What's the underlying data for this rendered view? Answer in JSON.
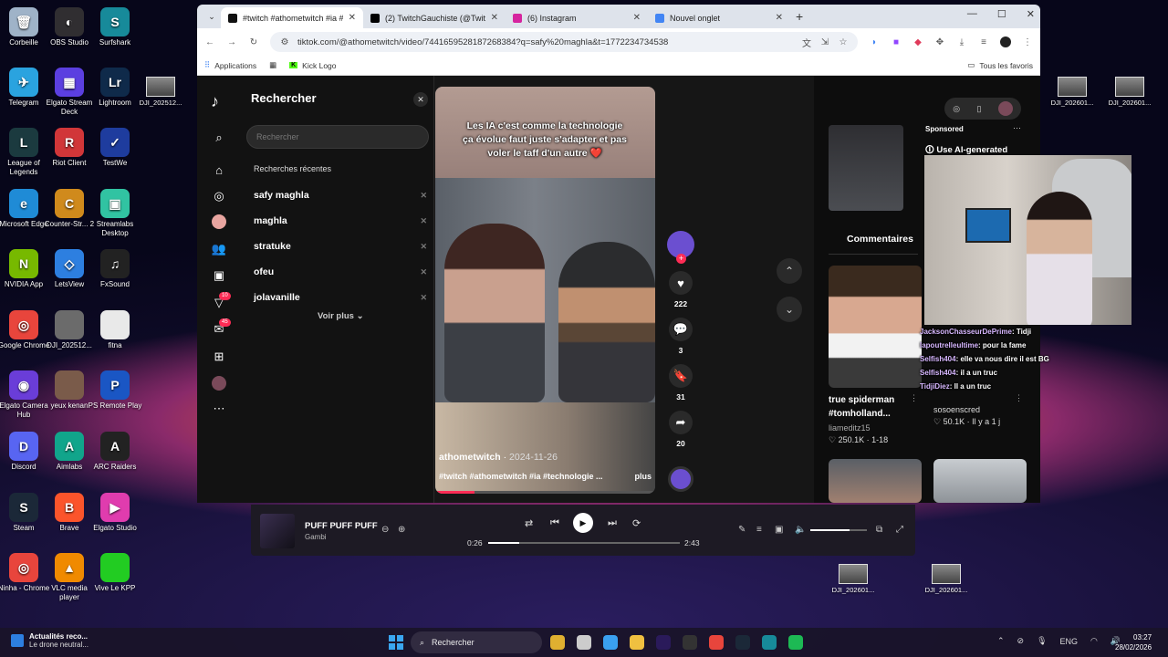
{
  "desktop": {
    "icons_col1": [
      {
        "label": "Corbeille",
        "color": "#9fb3c8",
        "glyph": "🗑"
      },
      {
        "label": "Telegram",
        "color": "#2aa3df",
        "glyph": "✈"
      },
      {
        "label": "League of Legends",
        "color": "#1b3a3f",
        "glyph": "L"
      },
      {
        "label": "Microsoft Edge",
        "color": "#1f8bd6",
        "glyph": "e"
      },
      {
        "label": "NVIDIA App",
        "color": "#77b900",
        "glyph": "N"
      },
      {
        "label": "Google Chrome",
        "color": "#e8453c",
        "glyph": "◎"
      },
      {
        "label": "Elgato Camera Hub",
        "color": "#6a3dd8",
        "glyph": "◉"
      },
      {
        "label": "Discord",
        "color": "#5865f2",
        "glyph": "D"
      },
      {
        "label": "Steam",
        "color": "#1b2838",
        "glyph": "S"
      },
      {
        "label": "Ninha - Chrome",
        "color": "#e8453c",
        "glyph": "◎"
      }
    ],
    "icons_col2": [
      {
        "label": "OBS Studio",
        "color": "#302e31",
        "glyph": "◐"
      },
      {
        "label": "Elgato Stream Deck",
        "color": "#5b3fe0",
        "glyph": "▦"
      },
      {
        "label": "Riot Client",
        "color": "#d13639",
        "glyph": "R"
      },
      {
        "label": "Counter-Str... 2",
        "color": "#d08a1c",
        "glyph": "C"
      },
      {
        "label": "LetsView",
        "color": "#2d7fe0",
        "glyph": "◇"
      },
      {
        "label": "DJI_202512...",
        "color": "#6b6b6b",
        "glyph": ""
      },
      {
        "label": "yeux kenan",
        "color": "#7a5b4a",
        "glyph": ""
      },
      {
        "label": "Aimlabs",
        "color": "#11a58b",
        "glyph": "A"
      },
      {
        "label": "Brave",
        "color": "#fb542b",
        "glyph": "B"
      },
      {
        "label": "VLC media player",
        "color": "#f08a00",
        "glyph": "▲"
      }
    ],
    "icons_col3": [
      {
        "label": "Surfshark",
        "color": "#178a9a",
        "glyph": "S"
      },
      {
        "label": "Lightroom",
        "color": "#0f2a4a",
        "glyph": "Lr"
      },
      {
        "label": "TestWe",
        "color": "#1e3c9e",
        "glyph": "✓"
      },
      {
        "label": "Streamlabs Desktop",
        "color": "#31c3a2",
        "glyph": "▣"
      },
      {
        "label": "FxSound",
        "color": "#222222",
        "glyph": "♫"
      },
      {
        "label": "fitna",
        "color": "#e9e9e9",
        "glyph": ""
      },
      {
        "label": "PS Remote Play",
        "color": "#1a56c4",
        "glyph": "P"
      },
      {
        "label": "ARC Raiders",
        "color": "#222222",
        "glyph": "A"
      },
      {
        "label": "Elgato Studio",
        "color": "#e03cae",
        "glyph": "▶"
      },
      {
        "label": "Vive Le KPP",
        "color": "#22cc22",
        "glyph": ""
      }
    ],
    "icons_col4": [
      {
        "label": "DJI_202512..."
      }
    ],
    "files_right": [
      {
        "label": "DJI_202601..."
      },
      {
        "label": "DJI_202601..."
      },
      {
        "label": "DJI_202601..."
      },
      {
        "label": "DJI_202601..."
      }
    ]
  },
  "browser": {
    "tabs": [
      {
        "title": "#twitch #athometwitch #ia #te",
        "color": "#111111",
        "active": true
      },
      {
        "title": "(2) TwitchGauchiste (@TwitchG",
        "color": "#000000",
        "active": false
      },
      {
        "title": "(6) Instagram",
        "color": "#d6249f",
        "active": false
      },
      {
        "title": "Nouvel onglet",
        "color": "#4285f4",
        "active": false
      }
    ],
    "url": "tiktok.com/@athometwitch/video/7441659528187268384?q=safy%20maghla&t=1772234734538",
    "bookmarks": [
      {
        "label": "Applications"
      },
      {
        "label": "Kick Logo"
      }
    ],
    "all_bookmarks": "Tous les favoris"
  },
  "tiktok": {
    "search": {
      "title": "Rechercher",
      "placeholder": "Rechercher",
      "recent_label": "Recherches récentes",
      "recent": [
        "safy maghla",
        "maghla",
        "stratuke",
        "ofeu",
        "jolavanille"
      ],
      "see_more": "Voir plus"
    },
    "rail_badges": {
      "inbox": "10",
      "messages": "45"
    },
    "video": {
      "caption": "Les IA c'est comme la technologie ça évolue faut juste s'adapter et pas voler le taff d'un autre ❤️",
      "author": "athometwitch",
      "date": "2024-11-26",
      "tags": "#twitch #athometwitch #ia #technologie ...",
      "more": "plus",
      "progress": 0.18
    },
    "actions": {
      "likes": "222",
      "comments": "3",
      "saves": "31",
      "shares": "20"
    },
    "right": {
      "comments_tab": "Commentaires",
      "sponsored": "Sponsored",
      "ai_generated": "Use AI-generated",
      "cards": [
        {
          "title": "true spiderman #tomholland...",
          "author": "liameditz15",
          "stats": "250.1K · 1-18"
        },
        {
          "title": "",
          "author": "sosoenscred",
          "stats": "50.1K · Il y a 1 j"
        }
      ]
    }
  },
  "chat": [
    {
      "user": "JacksonChasseurDePrime",
      "msg": "Tidji"
    },
    {
      "user": "lapoutrelleultime",
      "msg": "pour la fame"
    },
    {
      "user": "Selfish404",
      "msg": "elle va nous dire il est BG"
    },
    {
      "user": "Selfish404",
      "msg": "il a un truc"
    },
    {
      "user": "TidjiDiez",
      "msg": "Il a un truc"
    }
  ],
  "player": {
    "title": "PUFF PUFF PUFF",
    "artist": "Gambi",
    "elapsed": "0:26",
    "total": "2:43",
    "progress": 0.16,
    "volume": 0.7
  },
  "taskbar": {
    "news_title": "Actualités reco...",
    "news_sub": "Le drone neutral...",
    "search": "Rechercher",
    "lang": "ENG",
    "time": "03:27",
    "date": "28/02/2026"
  }
}
